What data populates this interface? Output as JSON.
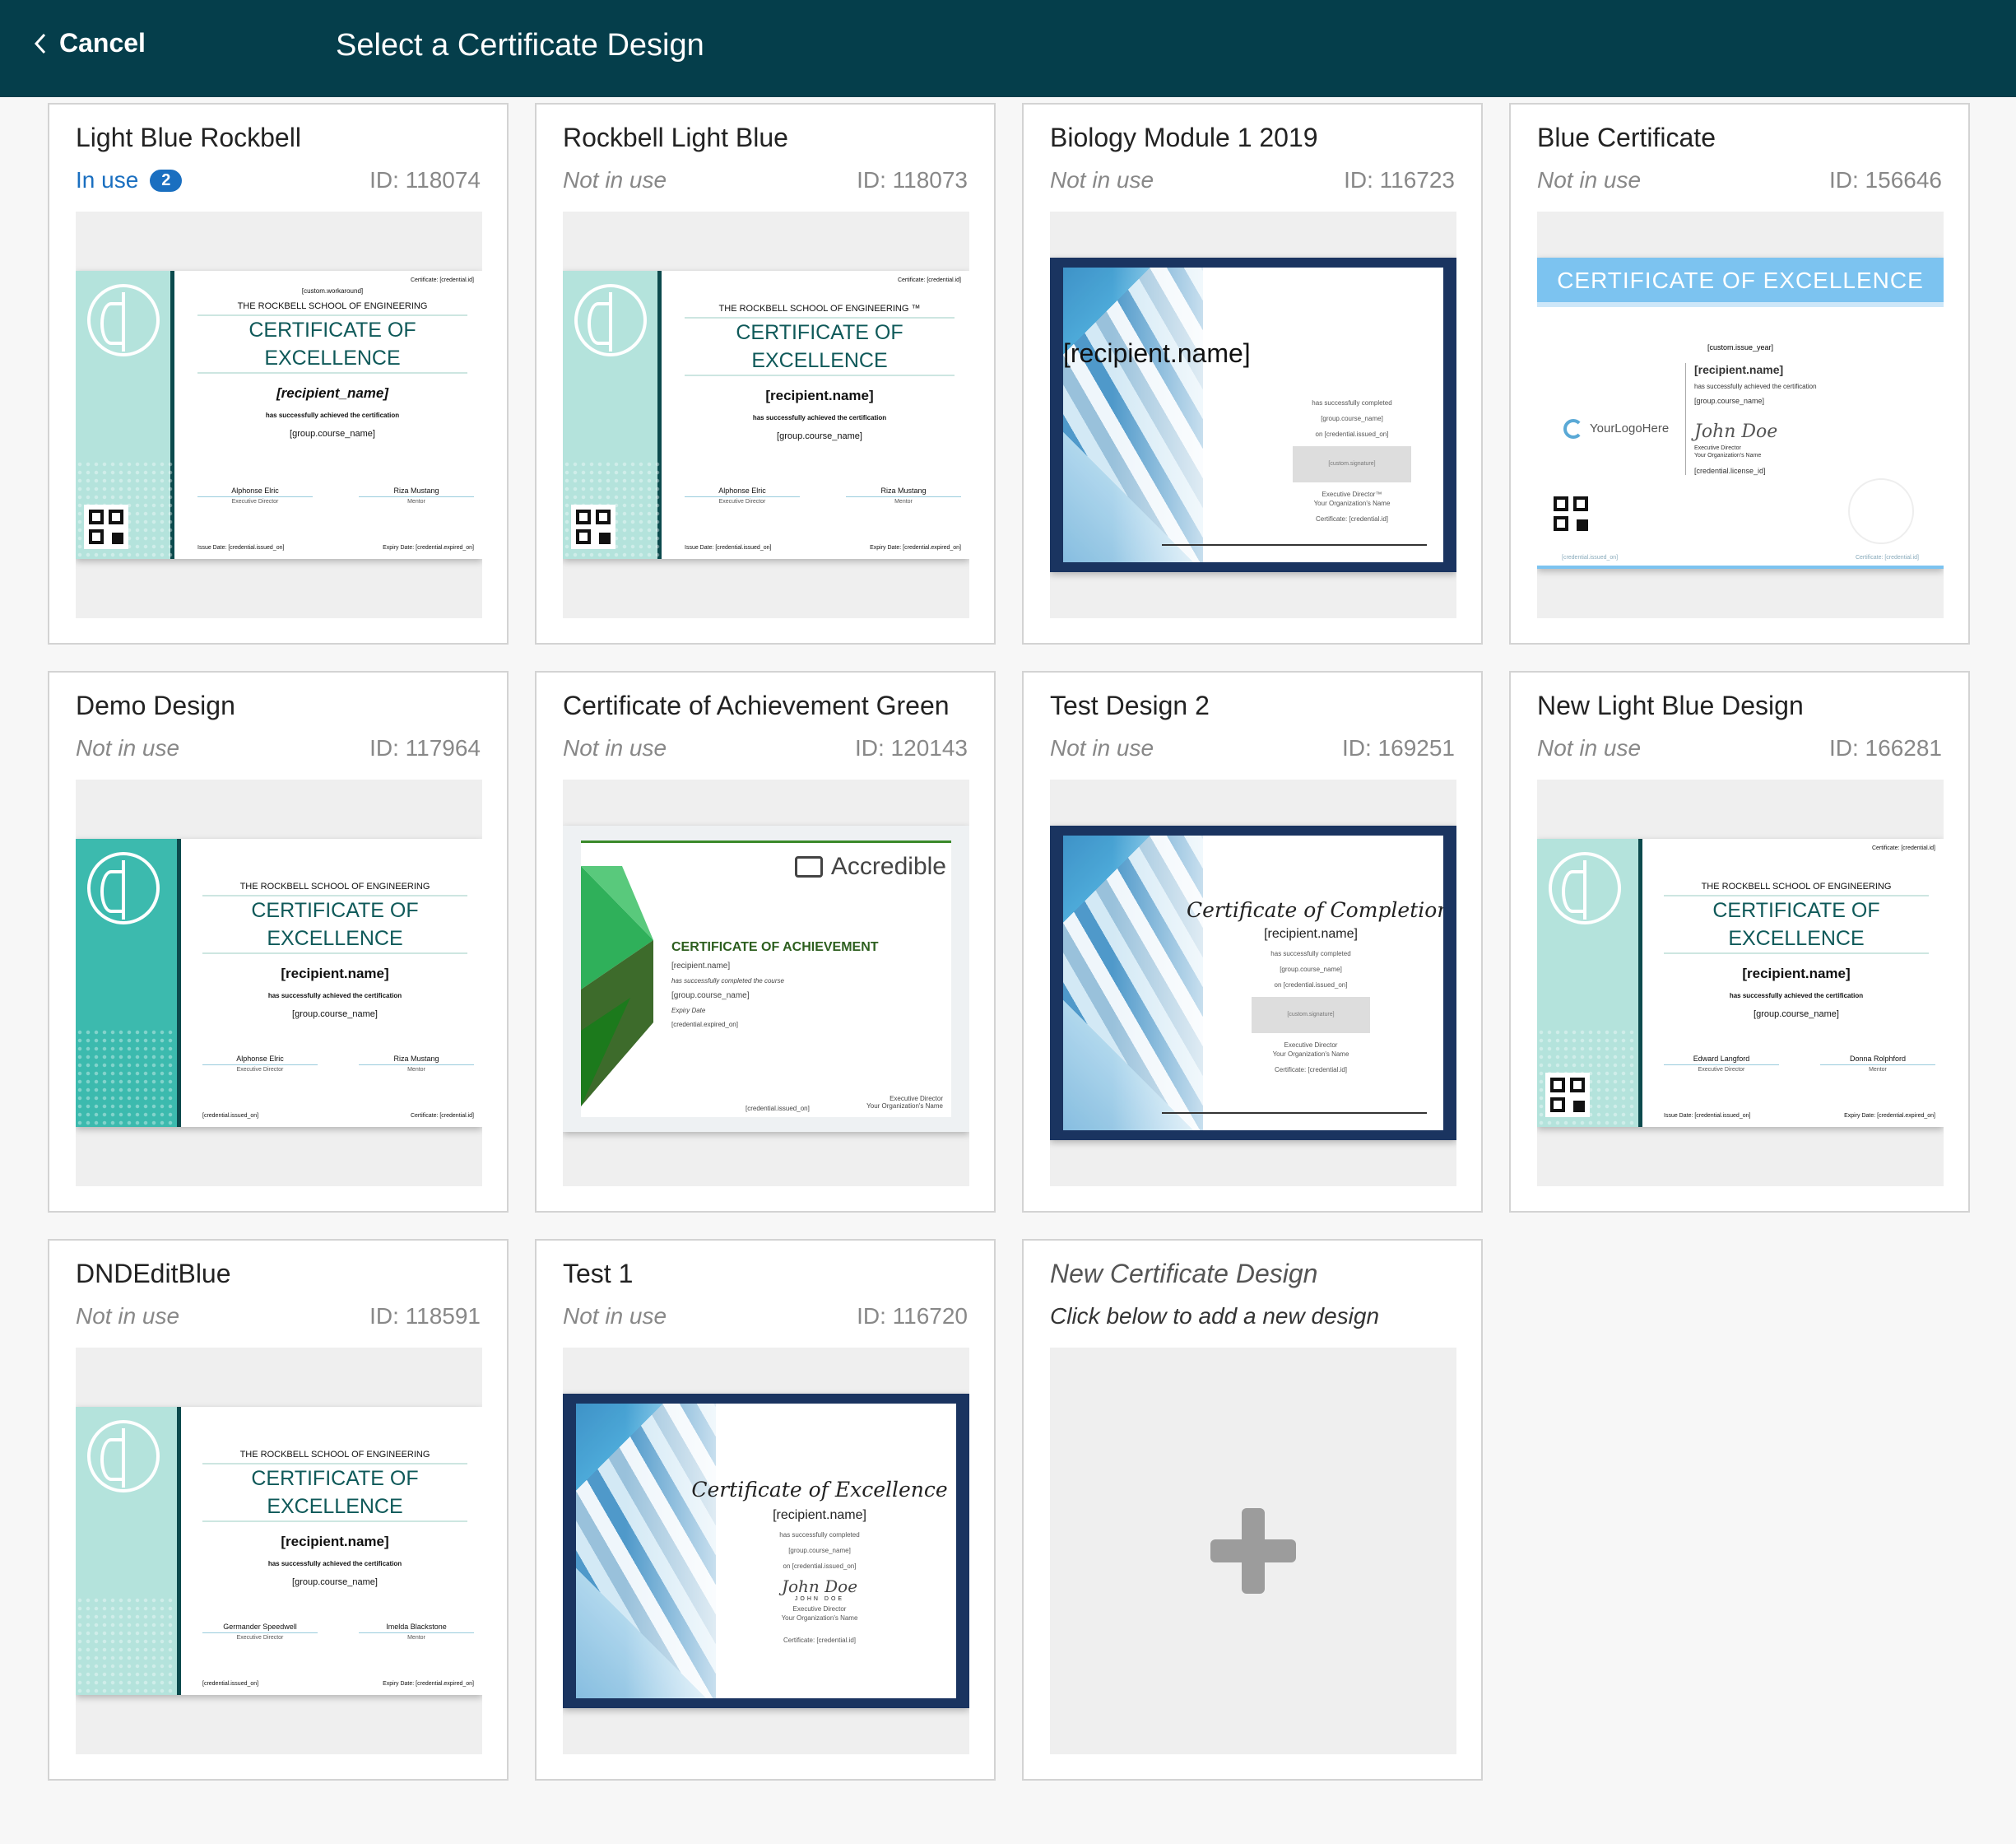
{
  "topbar": {
    "cancel_label": "Cancel",
    "title": "Select a Certificate Design",
    "icon": "chevron-left-icon"
  },
  "cards": [
    {
      "name": "Light Blue Rockbell",
      "status": "In use",
      "in_use_count": "2",
      "id": "ID: 118074"
    },
    {
      "name": "Rockbell Light Blue",
      "status": "Not in use",
      "id": "ID: 118073"
    },
    {
      "name": "Biology Module 1 2019",
      "status": "Not in use",
      "id": "ID: 116723"
    },
    {
      "name": "Blue Certificate",
      "status": "Not in use",
      "id": "ID: 156646"
    },
    {
      "name": "Demo Design",
      "status": "Not in use",
      "id": "ID: 117964"
    },
    {
      "name": "Certificate of Achievement Green",
      "status": "Not in use",
      "id": "ID: 120143"
    },
    {
      "name": "Test Design 2",
      "status": "Not in use",
      "id": "ID: 169251"
    },
    {
      "name": "New Light Blue Design",
      "status": "Not in use",
      "id": "ID: 166281"
    },
    {
      "name": "DNDEditBlue",
      "status": "Not in use",
      "id": "ID: 118591"
    },
    {
      "name": "Test 1",
      "status": "Not in use",
      "id": "ID: 116720"
    }
  ],
  "new_card": {
    "title": "New Certificate Design",
    "subtitle": "Click below to add a new design",
    "icon": "plus-icon"
  },
  "certs": {
    "teal": {
      "school": "THE ROCKBELL SCHOOL OF ENGINEERING",
      "school_tm": "THE ROCKBELL SCHOOL OF ENGINEERING ™",
      "heading": "CERTIFICATE OF EXCELLENCE",
      "recipient_us": "[recipient_name]",
      "recipient": "[recipient.name]",
      "achieved": "has successfully achieved the certification",
      "course": "[group.course_name]",
      "workaround": "[custom.workaround]",
      "cert_id": "Certificate:  [credential.id]",
      "sig1": "Alphonse Elric",
      "sig1_role": "Executive Director",
      "sig2": "Riza Mustang",
      "sig2_role": "Mentor",
      "sig3": "Edward Langford",
      "sig4": "Donna Rolphford",
      "sig5": "Germander Speedwell",
      "sig6": "Imelda Blackstone",
      "issue": "Issue Date:  [credential.issued_on]",
      "expiry": "Expiry Date:  [credential.expired_on]",
      "issued_only": "[credential.issued_on]",
      "expiry2": "Expiry Date:  [credential.expired_on]"
    },
    "geo": {
      "recipient": "[recipient.name]",
      "completed": "has successfully completed",
      "course": "[group.course_name]",
      "on": "on [credential.issued_on]",
      "signature": "[custom.signature]",
      "exec": "Executive Director™",
      "exec2": "Executive Director",
      "org": "Your Organization's Name",
      "cert": "Certificate: [credential.id]",
      "completion": "Certificate of Completion",
      "excellence": "Certificate of Excellence",
      "john": "John Doe",
      "john_caps": "JOHN DOE"
    },
    "blue": {
      "heading": "CERTIFICATE OF EXCELLENCE",
      "year": "[custom.issue_year]",
      "recipient": "[recipient.name]",
      "achieved": "has successfully achieved the certification",
      "course": "[group.course_name]",
      "logo": "YourLogoHere",
      "sig": "John Doe",
      "role": "Executive Director",
      "org": "Your Organization's Name",
      "license": "[credential.license_id]",
      "issued": "[credential.issued_on]",
      "cert": "Certificate: [credential.id]"
    },
    "green": {
      "brand": "Accredible",
      "heading": "CERTIFICATE OF ACHIEVEMENT",
      "recipient": "[recipient.name]",
      "completed": "has successfully completed the course",
      "course": "[group.course_name]",
      "expiry_label": "Expiry Date",
      "expiry": "[credential.expired_on]",
      "issued": "[credential.issued_on]",
      "exec": "Executive Director",
      "org": "Your Organization's Name"
    }
  }
}
